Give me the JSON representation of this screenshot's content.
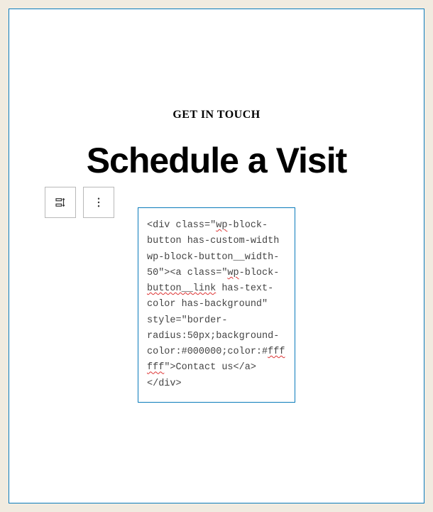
{
  "icons": {
    "reorder": "reorder-icon",
    "more": "more-vertical-icon"
  },
  "content": {
    "eyebrow": "GET IN TOUCH",
    "heading": "Schedule a Visit"
  },
  "code_block": {
    "seg1": "<div class=\"",
    "wp1": "wp",
    "seg2": "-block-button has-custom-width wp-block-button__width-50\"><a class=\"",
    "wp2": "wp",
    "seg3": "-block-",
    "btnlink": "button__link",
    "seg4": " has-text-color has-background\" style=\"border-radius:50px;background-color:#000000;color:#",
    "ffffff": "ffffff",
    "seg5": "\">Contact us</a></div>"
  }
}
